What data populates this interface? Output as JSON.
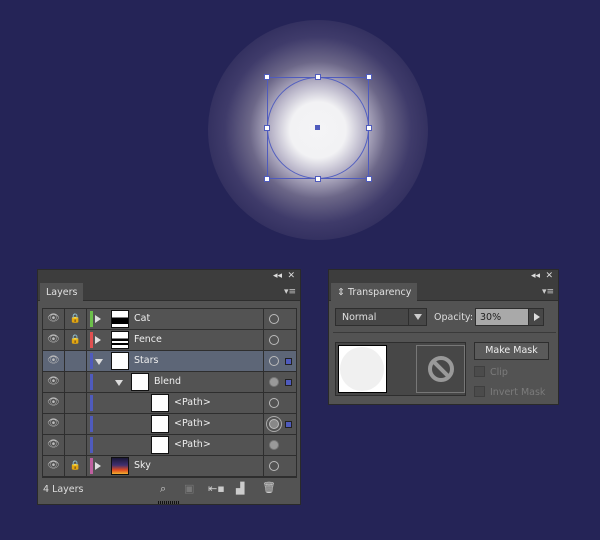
{
  "canvas": {
    "background": "#252457",
    "selection_color": "#4f5bbd"
  },
  "layers_panel": {
    "tab_label": "Layers",
    "collapse_icon": "double-chevron-left-icon",
    "close_icon": "close-icon",
    "menu_icon": "panel-menu-icon",
    "layers": [
      {
        "name": "Cat",
        "visible": true,
        "locked": true,
        "color": "#6cc04a",
        "expanded": false,
        "thumb": "cat",
        "target": "empty",
        "selected_square": false
      },
      {
        "name": "Fence",
        "visible": true,
        "locked": true,
        "color": "#e05050",
        "expanded": false,
        "thumb": "fence",
        "target": "empty",
        "selected_square": false
      },
      {
        "name": "Stars",
        "visible": true,
        "locked": false,
        "color": "#4f5bbd",
        "expanded": true,
        "thumb": "blank",
        "target": "empty",
        "selected_square": true,
        "active": true
      },
      {
        "name": "Blend",
        "visible": true,
        "locked": false,
        "color": "#4f5bbd",
        "expanded": true,
        "thumb": "blank",
        "target": "filled",
        "selected_square": true
      },
      {
        "name": "<Path>",
        "visible": true,
        "locked": false,
        "color": "#4f5bbd",
        "thumb": "blank",
        "target": "empty",
        "selected_square": false
      },
      {
        "name": "<Path>",
        "visible": true,
        "locked": false,
        "color": "#4f5bbd",
        "thumb": "blank",
        "target": "double",
        "selected_square": true
      },
      {
        "name": "<Path>",
        "visible": true,
        "locked": false,
        "color": "#4f5bbd",
        "thumb": "blank",
        "target": "filled",
        "selected_square": false
      },
      {
        "name": "Sky",
        "visible": true,
        "locked": true,
        "color": "#c060a0",
        "expanded": false,
        "thumb": "sky",
        "target": "empty",
        "selected_square": false
      }
    ],
    "footer_count": "4 Layers",
    "footer_buttons": [
      "locate-object-icon",
      "make-clipping-mask-icon",
      "create-sublayer-icon",
      "create-layer-icon",
      "delete-icon"
    ]
  },
  "transparency_panel": {
    "tab_label": "Transparency",
    "blend_mode": "Normal",
    "opacity_label": "Opacity:",
    "opacity_value": "30%",
    "make_mask_label": "Make Mask",
    "clip_label": "Clip",
    "invert_mask_label": "Invert Mask"
  }
}
